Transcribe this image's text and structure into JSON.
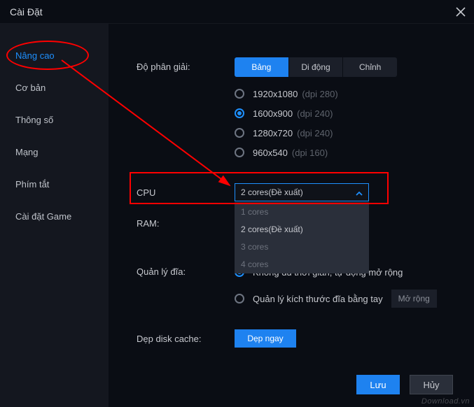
{
  "window": {
    "title": "Cài Đặt"
  },
  "sidebar": {
    "items": [
      {
        "label": "Nâng cao",
        "active": true
      },
      {
        "label": "Cơ bản"
      },
      {
        "label": "Thông số"
      },
      {
        "label": "Mạng"
      },
      {
        "label": "Phím tắt"
      },
      {
        "label": "Cài đặt Game"
      }
    ]
  },
  "settings": {
    "resolution": {
      "label": "Độ phân giải:",
      "tabs": [
        {
          "label": "Bảng",
          "active": true
        },
        {
          "label": "Di động"
        },
        {
          "label": "Chỉnh"
        }
      ],
      "options": [
        {
          "text": "1920x1080",
          "sub": "(dpi 280)",
          "selected": false
        },
        {
          "text": "1600x900",
          "sub": "(dpi 240)",
          "selected": true
        },
        {
          "text": "1280x720",
          "sub": "(dpi 240)",
          "selected": false
        },
        {
          "text": "960x540",
          "sub": "(dpi 160)",
          "selected": false
        }
      ]
    },
    "cpu": {
      "label": "CPU",
      "selected": "2 cores(Đề xuất)",
      "options": [
        {
          "label": "1 cores",
          "muted": true
        },
        {
          "label": "2 cores(Đề xuất)"
        },
        {
          "label": "3 cores",
          "muted": true
        },
        {
          "label": "4 cores",
          "muted": true
        }
      ]
    },
    "ram": {
      "label": "RAM:"
    },
    "disk": {
      "label": "Quản lý đĩa:",
      "auto_expand": "Không đủ thời gian, tự động mở rộng",
      "manual": "Quản lý kích thước đĩa bằng tay",
      "expand_btn": "Mở rộng"
    },
    "cache": {
      "label": "Dẹp disk cache:",
      "btn": "Dẹp ngay"
    }
  },
  "footer": {
    "save": "Lưu",
    "cancel": "Hủy"
  },
  "watermark": "Download.vn"
}
